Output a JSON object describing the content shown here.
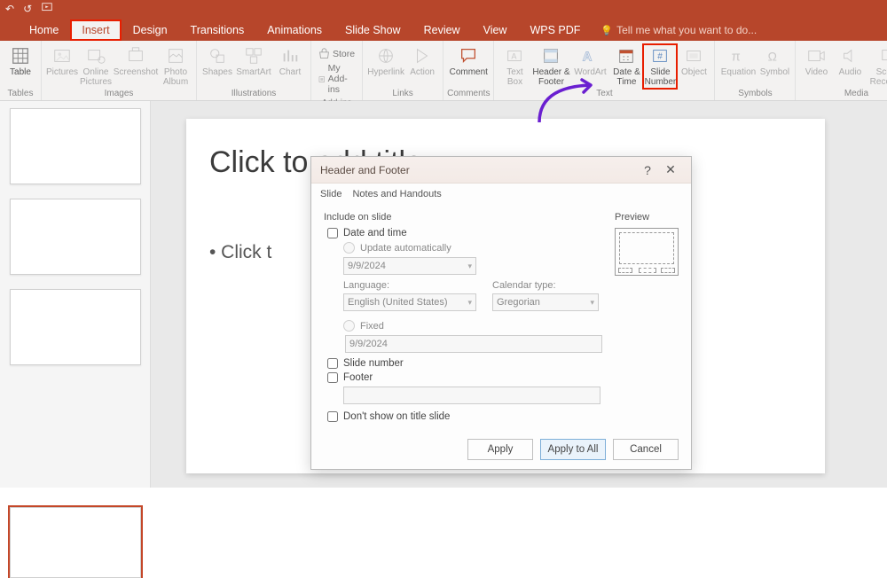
{
  "quick": {
    "undo": "↶",
    "redo": "↺"
  },
  "tabs": [
    "Home",
    "Insert",
    "Design",
    "Transitions",
    "Animations",
    "Slide Show",
    "Review",
    "View",
    "WPS PDF"
  ],
  "tellme": "Tell me what you want to do...",
  "ribbon": {
    "groups": {
      "tables": {
        "label": "Tables",
        "buttons": {
          "table": "Table"
        }
      },
      "images": {
        "label": "Images",
        "buttons": {
          "pictures": "Pictures",
          "online_pictures": "Online Pictures",
          "screenshot": "Screenshot",
          "photo_album": "Photo Album"
        }
      },
      "illustrations": {
        "label": "Illustrations",
        "buttons": {
          "shapes": "Shapes",
          "smartart": "SmartArt",
          "chart": "Chart"
        }
      },
      "addins": {
        "label": "Add-ins",
        "store": "Store",
        "myaddins": "My Add-ins"
      },
      "links": {
        "label": "Links",
        "buttons": {
          "hyperlink": "Hyperlink",
          "action": "Action"
        }
      },
      "comments": {
        "label": "Comments",
        "buttons": {
          "comment": "Comment"
        }
      },
      "text": {
        "label": "Text",
        "buttons": {
          "textbox": "Text Box",
          "header_footer": "Header & Footer",
          "wordart": "WordArt",
          "datetime": "Date & Time",
          "slidenumber": "Slide Number",
          "object": "Object"
        }
      },
      "symbols": {
        "label": "Symbols",
        "buttons": {
          "equation": "Equation",
          "symbol": "Symbol"
        }
      },
      "media": {
        "label": "Media",
        "buttons": {
          "video": "Video",
          "audio": "Audio",
          "screen_recording": "Screen Recording"
        }
      }
    }
  },
  "slide": {
    "title_placeholder": "Click to add title",
    "body_placeholder": "• Click t"
  },
  "dialog": {
    "title": "Header and Footer",
    "help": "?",
    "close": "✕",
    "tabs": {
      "slide": "Slide",
      "notes": "Notes and Handouts"
    },
    "include_label": "Include on slide",
    "preview_label": "Preview",
    "date_time": "Date and time",
    "update_auto": "Update automatically",
    "date_value": "9/9/2024",
    "language_label": "Language:",
    "language_value": "English (United States)",
    "calendar_label": "Calendar type:",
    "calendar_value": "Gregorian",
    "fixed": "Fixed",
    "fixed_value": "9/9/2024",
    "slide_number": "Slide number",
    "footer": "Footer",
    "dont_show": "Don't show on title slide",
    "buttons": {
      "apply": "Apply",
      "apply_all": "Apply to All",
      "cancel": "Cancel"
    }
  }
}
